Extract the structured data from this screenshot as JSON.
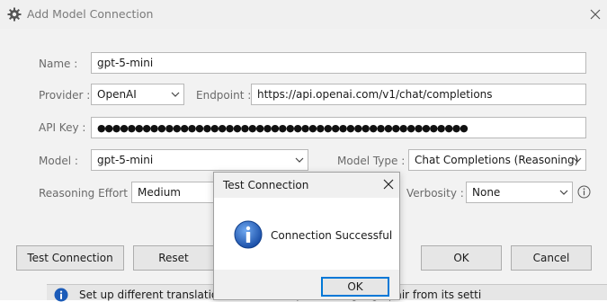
{
  "window": {
    "title": "Add Model Connection",
    "icon": "gear-icon",
    "close_icon": "close-icon"
  },
  "form": {
    "name_label": "Name :",
    "name_value": "gpt-5-mini",
    "provider_label": "Provider :",
    "provider_value": "OpenAI",
    "endpoint_label": "Endpoint :",
    "endpoint_value": "https://api.openai.com/v1/chat/completions",
    "api_key_label": "API Key :",
    "api_key_value": "●●●●●●●●●●●●●●●●●●●●●●●●●●●●●●●●●●●●●●●●●●●●●●●●●",
    "model_label": "Model :",
    "model_value": "gpt-5-mini",
    "model_type_label": "Model Type :",
    "model_type_value": "Chat Completions (Reasoning)",
    "reasoning_label": "Reasoning Effort :",
    "reasoning_value": "Medium",
    "verbosity_label": "Verbosity :",
    "verbosity_value": "None"
  },
  "buttons": {
    "test_connection": "Test Connection",
    "reset": "Reset",
    "ok": "OK",
    "cancel": "Cancel"
  },
  "info_bar": {
    "icon": "info-icon",
    "text": "Set up different translation m                                                ers for a specific language pair from its setti"
  },
  "dialog": {
    "title": "Test Connection",
    "message": "Connection Successful",
    "ok_label": "OK",
    "icon": "info-icon"
  },
  "colors": {
    "accent": "#0078d7",
    "info_blue": "#1b5bb8",
    "titlebar_bg": "#f0f0f0",
    "form_bg": "#f2f2f2"
  }
}
